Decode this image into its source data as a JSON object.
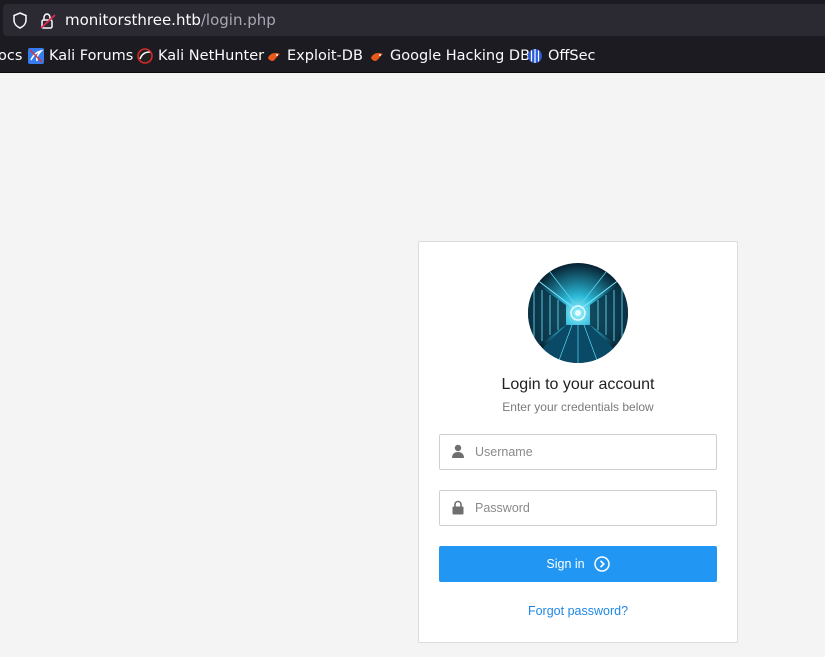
{
  "browser": {
    "url_host": "monitorsthree.htb",
    "url_path": "/login.php",
    "bookmarks": [
      {
        "label": "ocs",
        "icon": "docs-icon"
      },
      {
        "label": "Kali Forums",
        "icon": "kali-forums-icon"
      },
      {
        "label": "Kali NetHunter",
        "icon": "kali-nethunter-icon"
      },
      {
        "label": "Exploit-DB",
        "icon": "exploit-db-icon"
      },
      {
        "label": "Google Hacking DB",
        "icon": "google-hacking-db-icon"
      },
      {
        "label": "OffSec",
        "icon": "offsec-icon"
      }
    ]
  },
  "login": {
    "title": "Login to your account",
    "subtitle": "Enter your credentials below",
    "username_placeholder": "Username",
    "password_placeholder": "Password",
    "username_value": "",
    "password_value": "",
    "signin_label": "Sign in",
    "forgot_label": "Forgot password?",
    "avatar": "server-room-avatar"
  },
  "colors": {
    "accent": "#2196f3",
    "link": "#1e88e5",
    "page_bg": "#f4f4f4",
    "chrome_bg": "#1c1b22"
  }
}
